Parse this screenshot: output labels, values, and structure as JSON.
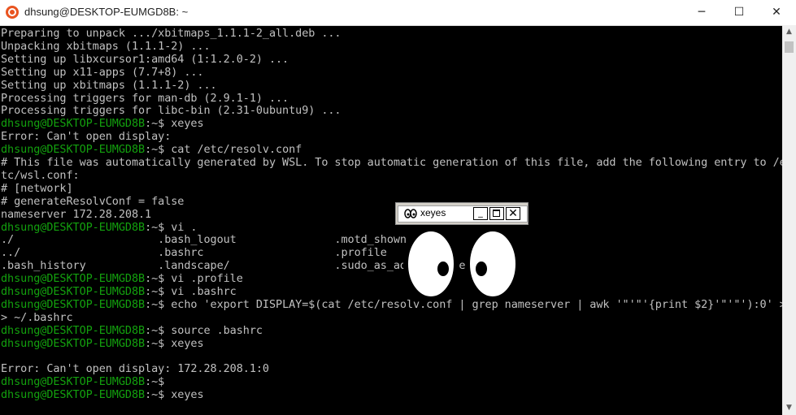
{
  "window": {
    "title": "dhsung@DESKTOP-EUMGD8B: ~",
    "minimize": "─",
    "maximize": "☐",
    "close": "✕"
  },
  "terminal": {
    "lines": [
      {
        "prompt": "",
        "text": "Preparing to unpack .../xbitmaps_1.1.1-2_all.deb ..."
      },
      {
        "prompt": "",
        "text": "Unpacking xbitmaps (1.1.1-2) ..."
      },
      {
        "prompt": "",
        "text": "Setting up libxcursor1:amd64 (1:1.2.0-2) ..."
      },
      {
        "prompt": "",
        "text": "Setting up x11-apps (7.7+8) ..."
      },
      {
        "prompt": "",
        "text": "Setting up xbitmaps (1.1.1-2) ..."
      },
      {
        "prompt": "",
        "text": "Processing triggers for man-db (2.9.1-1) ..."
      },
      {
        "prompt": "",
        "text": "Processing triggers for libc-bin (2.31-0ubuntu9) ..."
      },
      {
        "prompt": "dhsung@DESKTOP-EUMGD8B",
        "text": ":~$ xeyes"
      },
      {
        "prompt": "",
        "text": "Error: Can't open display:"
      },
      {
        "prompt": "dhsung@DESKTOP-EUMGD8B",
        "text": ":~$ cat /etc/resolv.conf"
      },
      {
        "prompt": "",
        "text": "# This file was automatically generated by WSL. To stop automatic generation of this file, add the following entry to /e"
      },
      {
        "prompt": "",
        "text": "tc/wsl.conf:"
      },
      {
        "prompt": "",
        "text": "# [network]"
      },
      {
        "prompt": "",
        "text": "# generateResolvConf = false"
      },
      {
        "prompt": "",
        "text": "nameserver 172.28.208.1"
      },
      {
        "prompt": "dhsung@DESKTOP-EUMGD8B",
        "text": ":~$ vi ."
      },
      {
        "prompt": "",
        "text": "./                      .bash_logout               .motd_shown"
      },
      {
        "prompt": "",
        "text": "../                     .bashrc                    .profile"
      },
      {
        "prompt": "",
        "text": ".bash_history           .landscape/                .sudo_as_admin_successful"
      },
      {
        "prompt": "dhsung@DESKTOP-EUMGD8B",
        "text": ":~$ vi .profile"
      },
      {
        "prompt": "dhsung@DESKTOP-EUMGD8B",
        "text": ":~$ vi .bashrc"
      },
      {
        "prompt": "dhsung@DESKTOP-EUMGD8B",
        "text": ":~$ echo 'export DISPLAY=$(cat /etc/resolv.conf | grep nameserver | awk '\"'\"'{print $2}'\"'\"'):0' >"
      },
      {
        "prompt": "",
        "text": "> ~/.bashrc"
      },
      {
        "prompt": "dhsung@DESKTOP-EUMGD8B",
        "text": ":~$ source .bashrc"
      },
      {
        "prompt": "dhsung@DESKTOP-EUMGD8B",
        "text": ":~$ xeyes"
      },
      {
        "prompt": "",
        "text": ""
      },
      {
        "prompt": "",
        "text": "Error: Can't open display: 172.28.208.1:0"
      },
      {
        "prompt": "dhsung@DESKTOP-EUMGD8B",
        "text": ":~$"
      },
      {
        "prompt": "dhsung@DESKTOP-EUMGD8B",
        "text": ":~$ xeyes"
      }
    ]
  },
  "scrollbar": {
    "up": "▲",
    "down": "▼"
  },
  "xeyes": {
    "title": "xeyes",
    "icon": "xeyes-icon",
    "minimize": "_",
    "close": "✕"
  },
  "colors": {
    "prompt": "#13a10e",
    "text": "#c0c0c0",
    "background": "#000000"
  }
}
